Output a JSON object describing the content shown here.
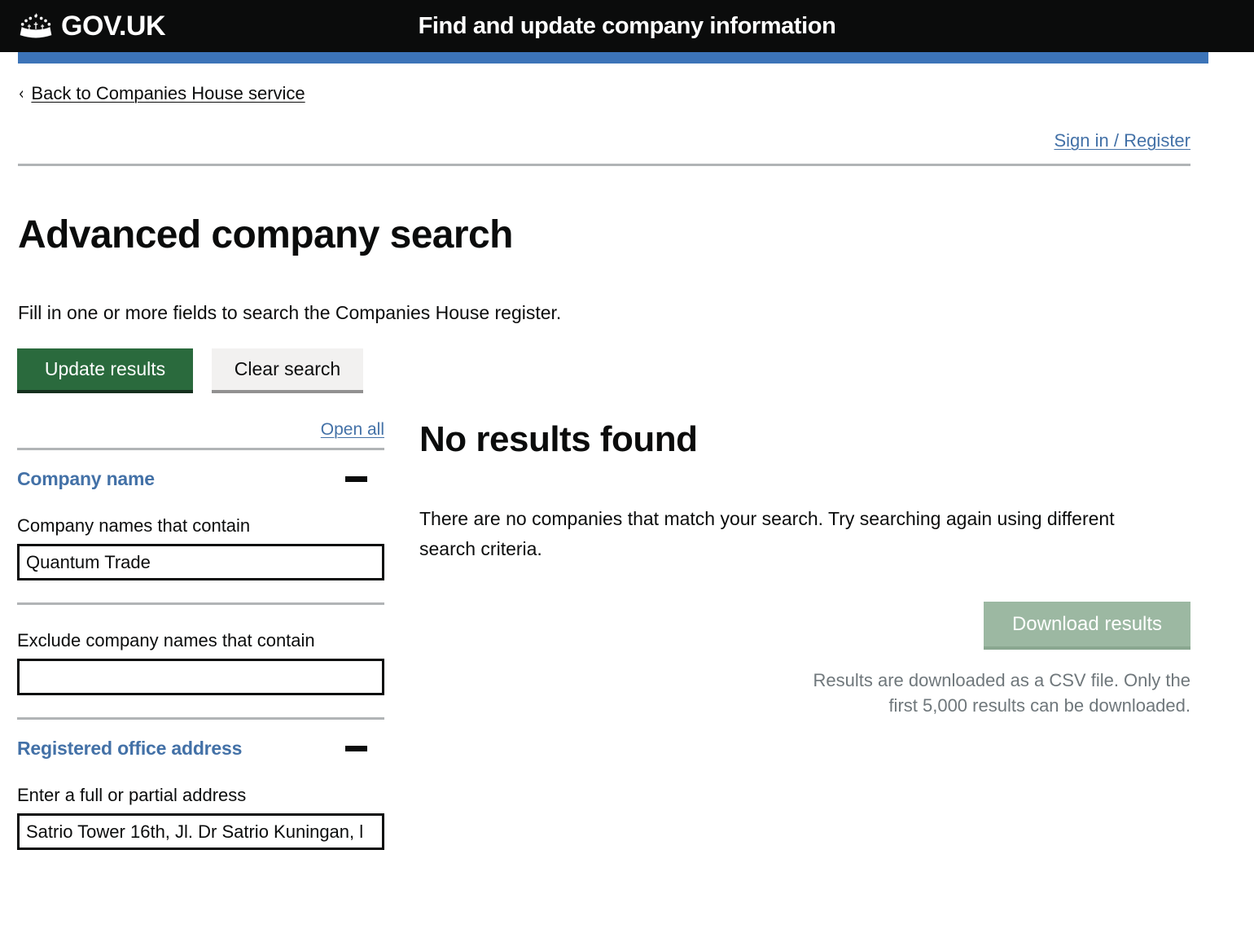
{
  "header": {
    "logo_text": "GOV.UK",
    "crown_icon": "crown-icon",
    "service_name": "Find and update company information"
  },
  "back_link": {
    "chevron": "‹",
    "label": "Back to Companies House service"
  },
  "account": {
    "sign_in_label": "Sign in / Register"
  },
  "page": {
    "title": "Advanced company search",
    "intro": "Fill in one or more fields to search the Companies House register."
  },
  "actions": {
    "update_label": "Update results",
    "clear_label": "Clear search"
  },
  "filters": {
    "open_all_label": "Open all",
    "sections": [
      {
        "title": "Company name",
        "toggle_icon": "minus-icon",
        "fields": [
          {
            "label": "Company names that contain",
            "value": "Quantum Trade",
            "placeholder": ""
          },
          {
            "label": "Exclude company names that contain",
            "value": "",
            "placeholder": ""
          }
        ]
      },
      {
        "title": "Registered office address",
        "toggle_icon": "minus-icon",
        "fields": [
          {
            "label": "Enter a full or partial address",
            "value": "Satrio Tower 16th, Jl. Dr Satrio Kuningan, l",
            "placeholder": ""
          }
        ]
      }
    ]
  },
  "results": {
    "heading": "No results found",
    "message": "There are no companies that match your search. Try searching again using different search criteria.",
    "download_label": "Download results",
    "download_note": "Results are downloaded as a CSV file. Only the first 5,000 results can be downloaded."
  },
  "colors": {
    "header_black": "#0b0c0c",
    "brand_blue_bar": "#3c74b8",
    "link_blue": "#4371a7",
    "button_green": "#2a6a3d",
    "button_grey": "#f2f1f0",
    "button_disabled_green": "#9cb8a2",
    "rule_grey": "#b1b4b6",
    "muted_text": "#6f777b"
  }
}
